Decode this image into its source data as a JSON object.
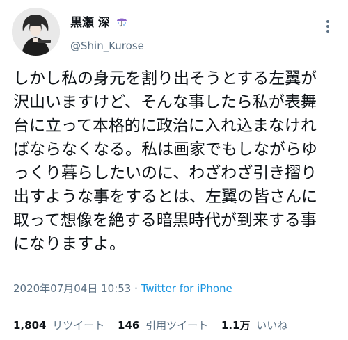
{
  "author": {
    "display_name": "黒瀬 深",
    "display_name_emoji": "umbrella-with-rain-drops",
    "username": "@Shin_Kurose"
  },
  "tweet": {
    "lines": [
      "しかし私の身元を割り出そうとする左翼が",
      "沢山いますけど、そんな事したら私が表舞",
      "台に立って本格的に政治に入れ込まなけれ",
      "ばならなくなる。私は画家でもしながらゆ",
      "っくり暮らしたいのに、わざわざ引き摺り",
      "出すような事をするとは、左翼の皆さんに",
      "取って想像を絶する暗黒時代が到来する事",
      "になりますよ。"
    ]
  },
  "meta": {
    "timestamp": "2020年07月04日 10:53",
    "separator": "·",
    "source": "Twitter for iPhone"
  },
  "stats": {
    "retweets_count": "1,804",
    "retweets_label": "リツイート",
    "quotes_count": "146",
    "quotes_label": "引用ツイート",
    "likes_count": "1.1万",
    "likes_label": "いいね"
  },
  "colors": {
    "text": "#0f1419",
    "secondary": "#5b7083",
    "link": "#1b95e0",
    "divider": "#e1e8ed"
  }
}
